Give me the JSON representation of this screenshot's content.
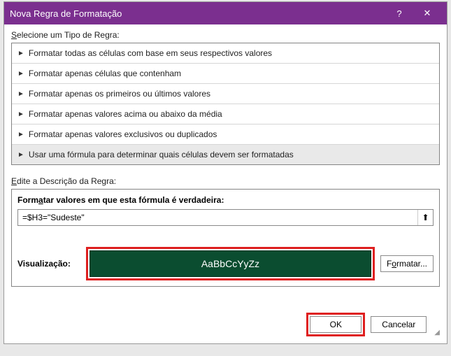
{
  "titlebar": {
    "title": "Nova Regra de Formatação",
    "help": "?",
    "close": "✕"
  },
  "ruleType": {
    "label_pre": "S",
    "label_rest": "elecione um Tipo de Regra:",
    "items": [
      "Formatar todas as células com base em seus respectivos valores",
      "Formatar apenas células que contenham",
      "Formatar apenas os primeiros ou últimos valores",
      "Formatar apenas valores acima ou abaixo da média",
      "Formatar apenas valores exclusivos ou duplicados",
      "Usar uma fórmula para determinar quais células devem ser formatadas"
    ],
    "selectedIndex": 5
  },
  "editSection": {
    "label_pre": "E",
    "label_rest": "dite a Descrição da Regra:",
    "formulaLabel_pre": "Form",
    "formulaLabel_u": "a",
    "formulaLabel_rest": "tar valores em que esta fórmula é verdadeira:",
    "formulaValue": "=$H3=\"Sudeste\"",
    "rangeIcon": "⬆"
  },
  "preview": {
    "label": "Visualização:",
    "sample": "AaBbCcYyZz",
    "formatButton_pre": "F",
    "formatButton_u": "o",
    "formatButton_rest": "rmatar..."
  },
  "buttons": {
    "ok": "OK",
    "cancel": "Cancelar"
  }
}
